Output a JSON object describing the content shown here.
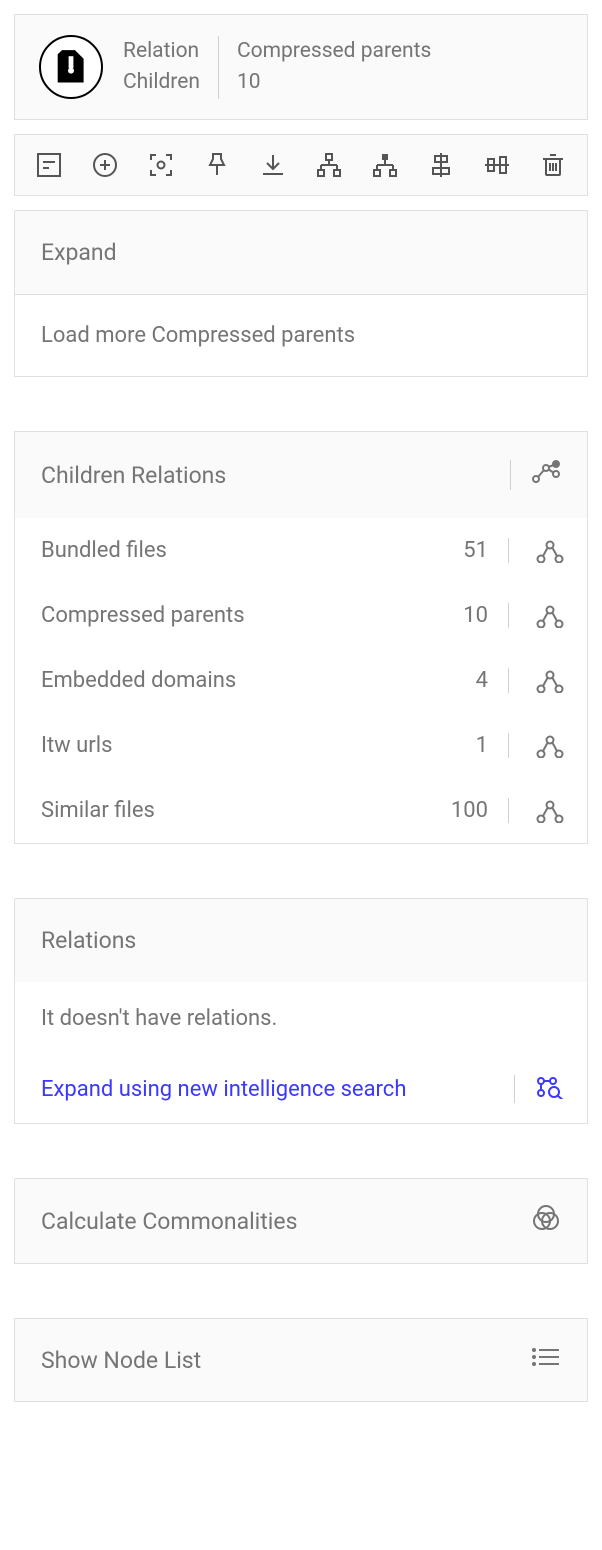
{
  "header": {
    "left_line1": "Relation",
    "left_line2": "Children",
    "right_line1": "Compressed parents",
    "right_line2": "10"
  },
  "sections": {
    "expand": {
      "title": "Expand",
      "load_more": "Load more Compressed parents"
    },
    "children_relations": {
      "title": "Children Relations",
      "rows": [
        {
          "label": "Bundled files",
          "count": "51"
        },
        {
          "label": "Compressed parents",
          "count": "10"
        },
        {
          "label": "Embedded domains",
          "count": "4"
        },
        {
          "label": "Itw urls",
          "count": "1"
        },
        {
          "label": "Similar files",
          "count": "100"
        }
      ]
    },
    "relations": {
      "title": "Relations",
      "empty_text": "It doesn't have relations.",
      "expand_search": "Expand using new intelligence search"
    },
    "commonalities": {
      "title": "Calculate Commonalities"
    },
    "node_list": {
      "title": "Show Node List"
    }
  }
}
